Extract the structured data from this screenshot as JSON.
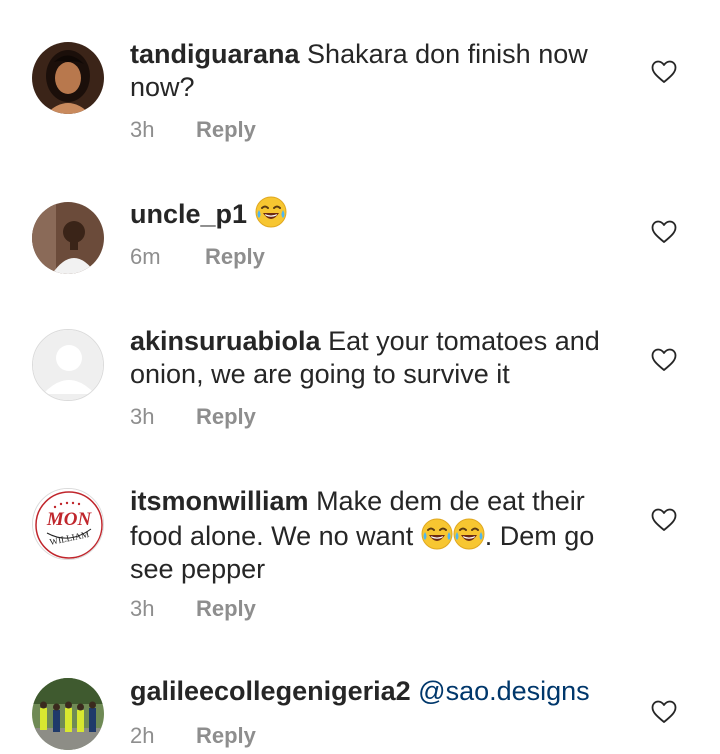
{
  "comments": [
    {
      "username": "tandiguarana",
      "text": "Shakara don finish now now?",
      "time": "3h",
      "reply": "Reply",
      "avatar": "profile-photo"
    },
    {
      "username": "uncle_p1",
      "text": "",
      "emoji_count": 1,
      "time": "6m",
      "reply": "Reply",
      "avatar": "profile-photo"
    },
    {
      "username": "akinsuruabiola",
      "text": "Eat your tomatoes and onion, we are going to survive it",
      "time": "3h",
      "reply": "Reply",
      "avatar": "default-avatar"
    },
    {
      "username": "itsmonwilliam",
      "text_before": "Make dem de eat their food alone. We no want ",
      "text_after": ". Dem go see pepper",
      "emoji_count": 2,
      "time": "3h",
      "reply": "Reply",
      "avatar": "logo",
      "logo_text_top": "MON",
      "logo_text_bottom": "WILLIAM"
    },
    {
      "username": "galileecollegenigeria2",
      "mention": "@sao.designs",
      "time": "2h",
      "reply": "Reply",
      "avatar": "group-photo"
    }
  ],
  "icons": {
    "like": "heart-outline-icon",
    "emoji": "face-with-tears-of-joy-icon"
  },
  "colors": {
    "text": "#262626",
    "meta": "#8e8e8e",
    "mention": "#00376b",
    "logo_red": "#c0262c"
  }
}
